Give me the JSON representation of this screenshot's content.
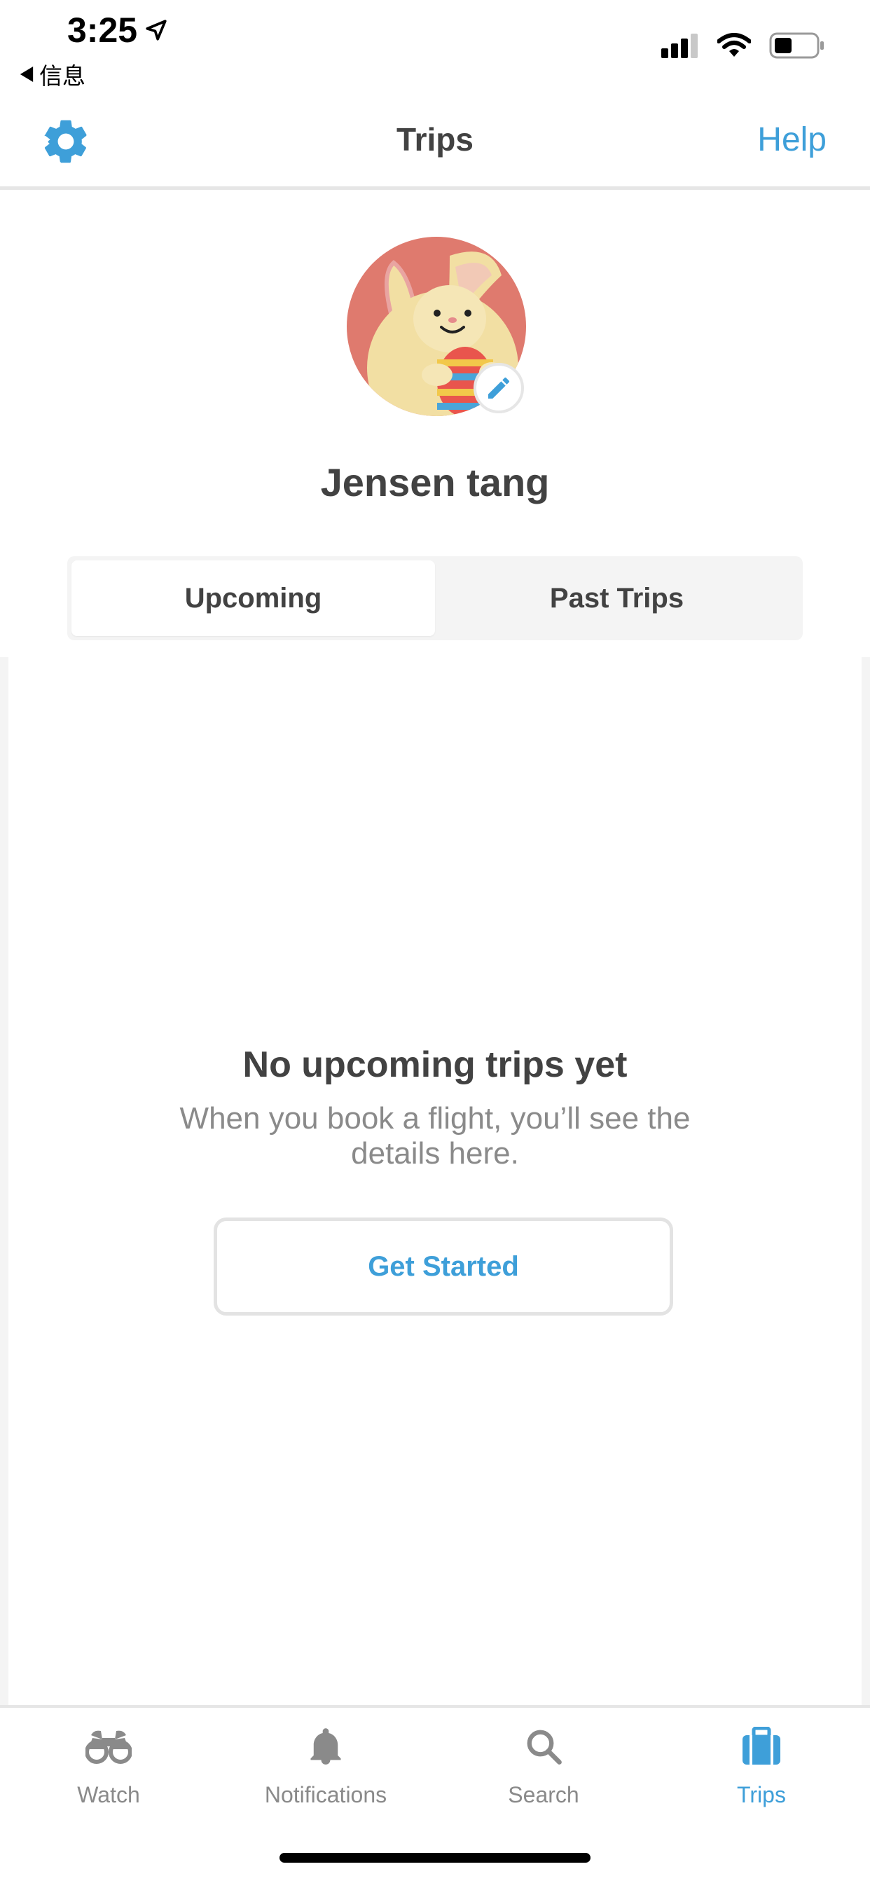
{
  "status_bar": {
    "time": "3:25",
    "back_label": "信息"
  },
  "navbar": {
    "title": "Trips",
    "help_label": "Help",
    "settings_icon": "gear-icon"
  },
  "profile": {
    "name": "Jensen tang",
    "avatar_icon": "bunny-easter-egg-avatar",
    "edit_icon": "pencil-icon"
  },
  "segments": [
    {
      "label": "Upcoming",
      "active": true
    },
    {
      "label": "Past Trips",
      "active": false
    }
  ],
  "empty_state": {
    "title": "No upcoming trips yet",
    "subtitle": "When you book a flight, you’ll see the details here.",
    "button_label": "Get Started"
  },
  "tabs": [
    {
      "label": "Watch",
      "icon": "binoculars-icon",
      "active": false
    },
    {
      "label": "Notifications",
      "icon": "bell-icon",
      "active": false
    },
    {
      "label": "Search",
      "icon": "search-icon",
      "active": false
    },
    {
      "label": "Trips",
      "icon": "suitcase-icon",
      "active": true
    }
  ],
  "colors": {
    "accent": "#3e9fd9",
    "text_primary": "#424242",
    "text_secondary": "#8a8a8a",
    "avatar_background": "#df7a6e"
  }
}
